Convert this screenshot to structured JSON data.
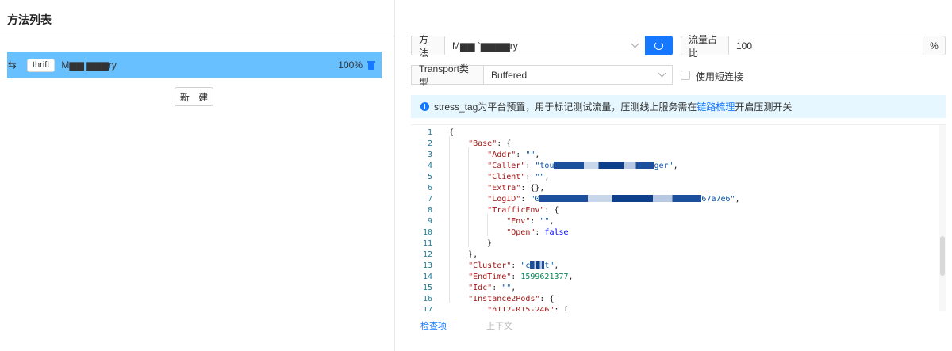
{
  "left": {
    "title": "方法列表",
    "method_row": {
      "tag": "thrift",
      "name": "M▆▆  ▆▆▆ry",
      "percent": "100%"
    },
    "new_button": "新 建"
  },
  "right": {
    "method_label": "方法",
    "method_value": "M▆▆ `▆▆▆▆ry",
    "traffic_label": "流量占比",
    "traffic_value": "100",
    "traffic_unit": "%",
    "transport_label": "Transport类型",
    "transport_value": "Buffered",
    "short_conn_label": "使用短连接",
    "alert": {
      "before": "stress_tag为平台预置，用于标记测试流量，压测线上服务需在",
      "link": "链路梳理",
      "after": "开启压测开关"
    },
    "tabs": [
      "检查项",
      "上下文"
    ]
  },
  "editor": {
    "lines": [
      {
        "n": "1",
        "html": "<span class=\"p\">{</span>"
      },
      {
        "n": "2",
        "html": "    <span class=\"k\">\"Base\"</span><span class=\"p\">: {</span>"
      },
      {
        "n": "3",
        "html": "        <span class=\"k\">\"Addr\"</span><span class=\"p\">: </span><span class=\"s\">\"\"</span><span class=\"p\">,</span>"
      },
      {
        "n": "4",
        "html": "        <span class=\"k\">\"Caller\"</span><span class=\"p\">: </span><span class=\"s\">\"tou▆▆▆▆▆▆▆▆▆▆▆▆▆▆▆▆▆▆▆▆▆ger\"</span><span class=\"p\">,</span>"
      },
      {
        "n": "5",
        "html": "        <span class=\"k\">\"Client\"</span><span class=\"p\">: </span><span class=\"s\">\"\"</span><span class=\"p\">,</span>"
      },
      {
        "n": "6",
        "html": "        <span class=\"k\">\"Extra\"</span><span class=\"p\">: {},</span>"
      },
      {
        "n": "7",
        "html": "        <span class=\"k\">\"LogID\"</span><span class=\"p\">: </span><span class=\"s\">\"0▆▆▆▆▆▆▆▆▆▆▆▆▆▆▆▆▆▆▆▆▆▆▆▆▆▆▆▆▆▆▆▆▆▆67a7e6\"</span><span class=\"p\">,</span>"
      },
      {
        "n": "8",
        "html": "        <span class=\"k\">\"TrafficEnv\"</span><span class=\"p\">: {</span>"
      },
      {
        "n": "9",
        "html": "            <span class=\"k\">\"Env\"</span><span class=\"p\">: </span><span class=\"s\">\"\"</span><span class=\"p\">,</span>"
      },
      {
        "n": "10",
        "html": "            <span class=\"k\">\"Open\"</span><span class=\"p\">: </span><span class=\"b\">false</span>"
      },
      {
        "n": "11",
        "html": "        <span class=\"p\">}</span>"
      },
      {
        "n": "12",
        "html": "    <span class=\"p\">},</span>"
      },
      {
        "n": "13",
        "html": "    <span class=\"k\">\"Cluster\"</span><span class=\"p\">: </span><span class=\"s\">\"c▆▆▆t\"</span><span class=\"p\">,</span>"
      },
      {
        "n": "14",
        "html": "    <span class=\"k\">\"EndTime\"</span><span class=\"p\">: </span><span class=\"n\">1599621377</span><span class=\"p\">,</span>"
      },
      {
        "n": "15",
        "html": "    <span class=\"k\">\"Idc\"</span><span class=\"p\">: </span><span class=\"s\">\"\"</span><span class=\"p\">,</span>"
      },
      {
        "n": "16",
        "html": "    <span class=\"k\">\"Instance2Pods\"</span><span class=\"p\">: {</span>"
      },
      {
        "n": "17",
        "html": "        <span class=\"k\">\"n112-015-246\"</span><span class=\"p\">: [</span>"
      }
    ]
  },
  "colors": {
    "accent": "#1677ff",
    "selected_row": "#69c0ff",
    "alert_bg": "#e6f7ff"
  }
}
